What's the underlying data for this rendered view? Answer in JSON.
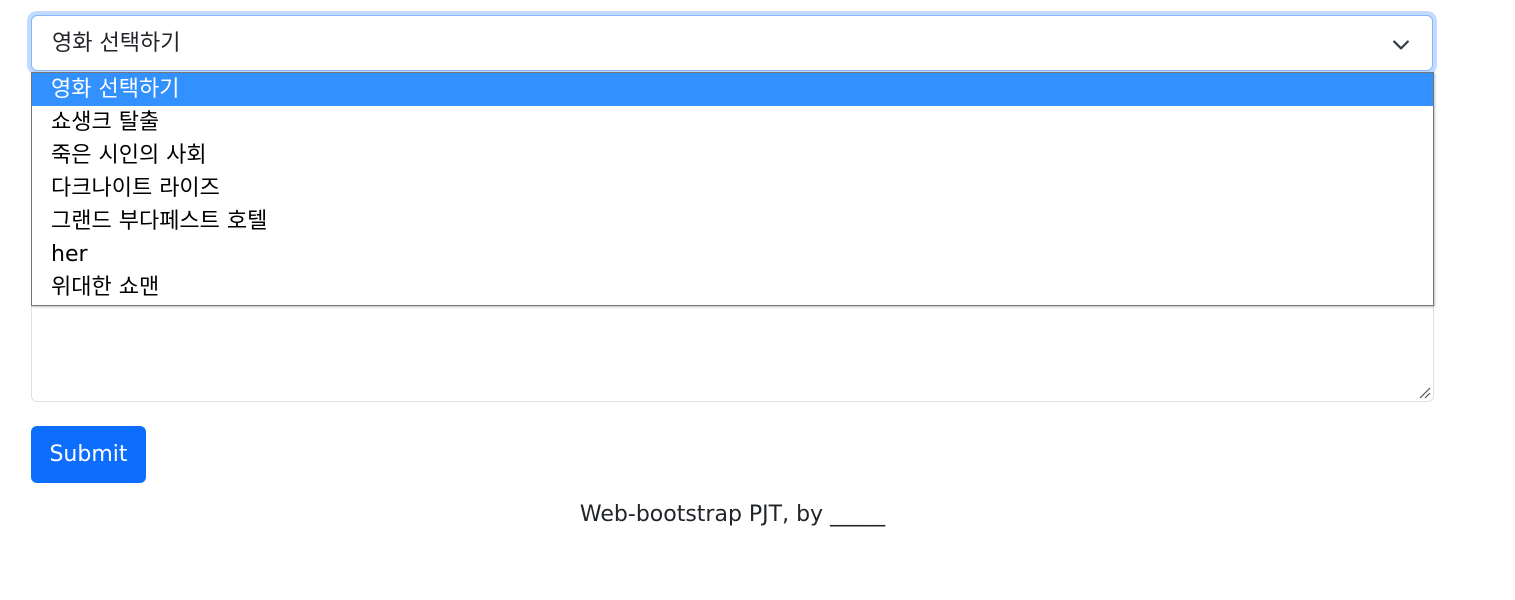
{
  "form": {
    "select": {
      "value": "영화 선택하기",
      "options": [
        "영화 선택하기",
        "쇼생크 탈출",
        "죽은 시인의 사회",
        "다크나이트 라이즈",
        "그랜드 부다페스트 호텔",
        "her",
        "위대한 쇼맨"
      ],
      "highlighted_index": 0
    },
    "textarea": {
      "value": ""
    },
    "submit_label": "Submit"
  },
  "footer": {
    "text": "Web-bootstrap PJT, by _____"
  },
  "colors": {
    "primary": "#0d6efd",
    "focus_ring": "#86b7fe",
    "option_highlight": "#3390ff"
  },
  "icons": {
    "select_chevron": "chevron-down-icon",
    "textarea_resize": "resize-grip-icon"
  }
}
